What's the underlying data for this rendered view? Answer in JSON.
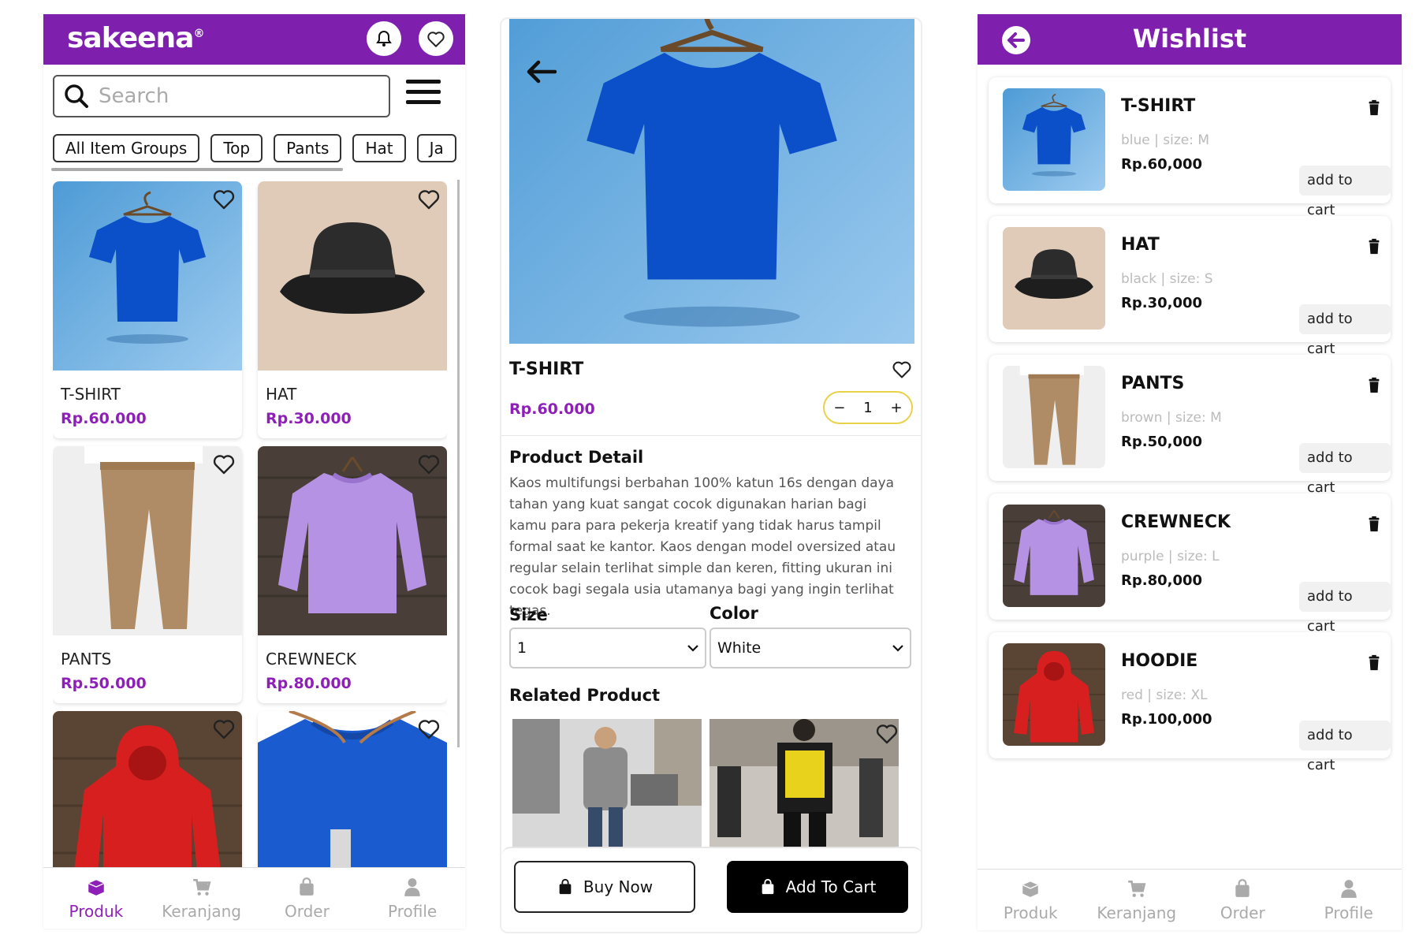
{
  "colors": {
    "brand": "#7e1fae",
    "price": "#8e1fb8",
    "accent_qty": "#e8d24a"
  },
  "home": {
    "logo": "sakeena",
    "logo_mark": "®",
    "search": {
      "placeholder": "Search",
      "value": ""
    },
    "chips": [
      "All Item Groups",
      "Top",
      "Pants",
      "Hat",
      "Ja"
    ],
    "products": [
      {
        "name": "T-SHIRT",
        "price": "Rp.60.000",
        "icon": "tshirt-image"
      },
      {
        "name": "HAT",
        "price": "Rp.30.000",
        "icon": "hat-image"
      },
      {
        "name": "PANTS",
        "price": "Rp.50.000",
        "icon": "pants-image"
      },
      {
        "name": "CREWNECK",
        "price": "Rp.80.000",
        "icon": "crewneck-image"
      },
      {
        "name": "",
        "price": "",
        "icon": "hoodie-image"
      },
      {
        "name": "",
        "price": "",
        "icon": "shirt-tag-image"
      }
    ],
    "nav": [
      {
        "label": "Produk",
        "icon": "box-icon",
        "active": true
      },
      {
        "label": "Keranjang",
        "icon": "cart-icon",
        "active": false
      },
      {
        "label": "Order",
        "icon": "bag-icon",
        "active": false
      },
      {
        "label": "Profile",
        "icon": "user-icon",
        "active": false
      }
    ]
  },
  "detail": {
    "title": "T-SHIRT",
    "price": "Rp.60.000",
    "qty": {
      "minus": "−",
      "value": "1",
      "plus": "+"
    },
    "product_detail_heading": "Product Detail",
    "description": "Kaos multifungsi berbahan 100% katun 16s dengan daya tahan yang kuat sangat cocok digunakan harian bagi kamu para para pekerja kreatif yang tidak harus tampil formal saat ke kantor. Kaos dengan model oversized atau regular selain terlihat simple dan keren, fitting ukuran ini cocok bagi segala usia utamanya bagi yang ingin terlihat tegas.",
    "size_label": "Size",
    "size_value": "1",
    "color_label": "Color",
    "color_value": "White",
    "related_heading": "Related Product",
    "buy_now": "Buy Now",
    "add_to_cart": "Add To Cart"
  },
  "wishlist": {
    "title": "Wishlist",
    "items": [
      {
        "name": "T-SHIRT",
        "meta": "blue | size: M",
        "price": "Rp.60,000",
        "action": "add to cart"
      },
      {
        "name": "HAT",
        "meta": "black | size: S",
        "price": "Rp.30,000",
        "action": "add to cart"
      },
      {
        "name": "PANTS",
        "meta": "brown | size: M",
        "price": "Rp.50,000",
        "action": "add to cart"
      },
      {
        "name": "CREWNECK",
        "meta": "purple | size: L",
        "price": "Rp.80,000",
        "action": "add to cart"
      },
      {
        "name": "HOODIE",
        "meta": "red | size: XL",
        "price": "Rp.100,000",
        "action": "add to cart"
      }
    ],
    "nav": [
      {
        "label": "Produk",
        "icon": "box-icon",
        "active": false
      },
      {
        "label": "Keranjang",
        "icon": "cart-icon",
        "active": false
      },
      {
        "label": "Order",
        "icon": "bag-icon",
        "active": false
      },
      {
        "label": "Profile",
        "icon": "user-icon",
        "active": false
      }
    ]
  }
}
